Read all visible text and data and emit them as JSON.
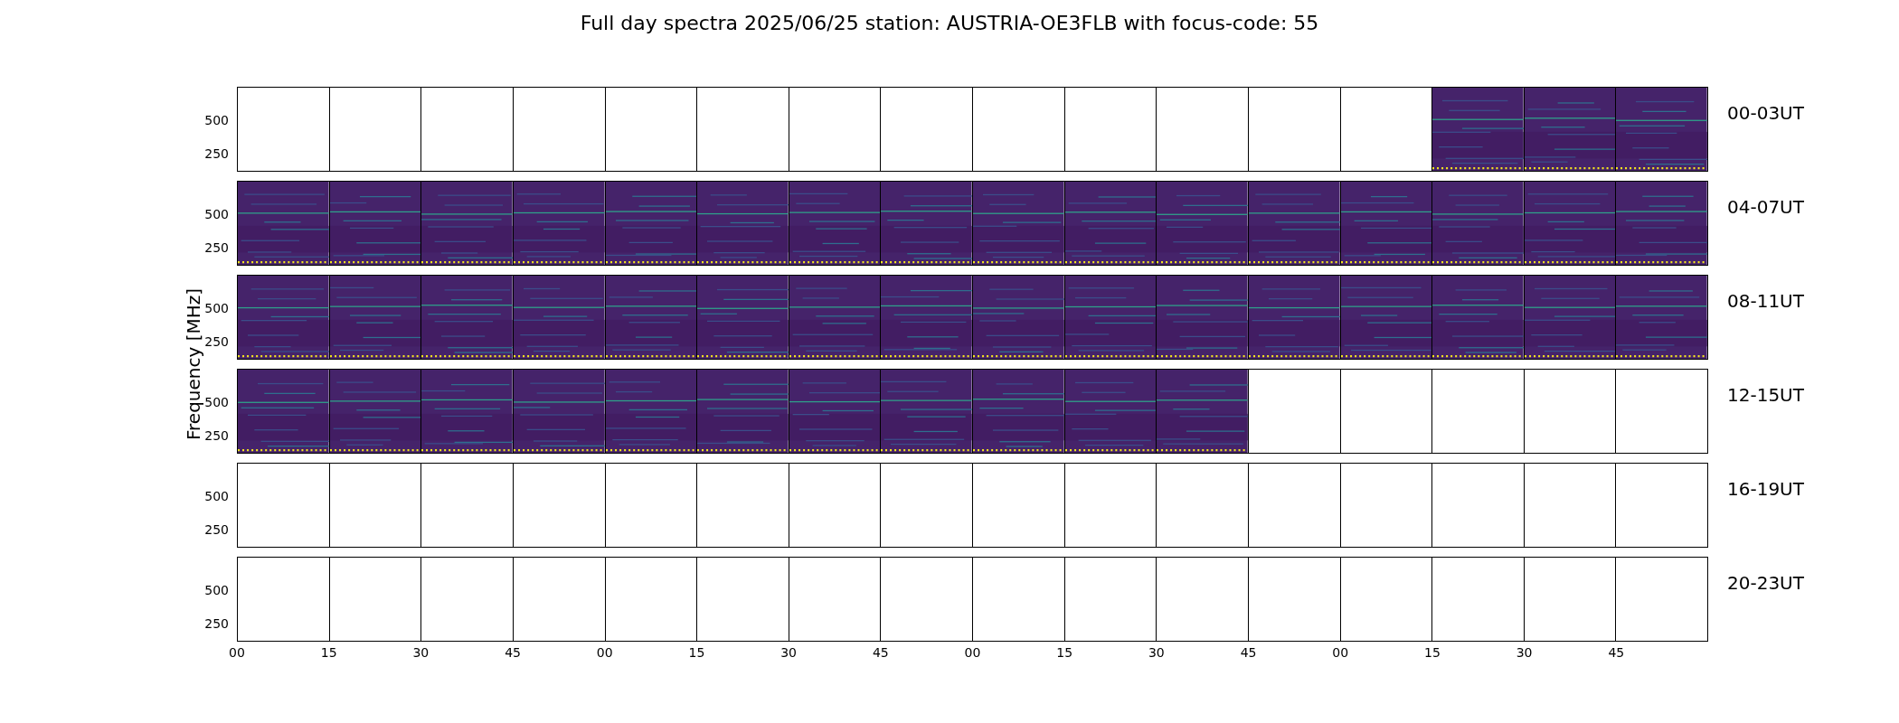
{
  "title": "Full day spectra 2025/06/25 station: AUSTRIA-OE3FLB with focus-code: 55",
  "ylabel": "Frequency [MHz]",
  "rows": [
    {
      "label": "00-03UT",
      "yticks": [
        "500",
        "250"
      ],
      "panels": [
        {
          "kind": "empty"
        },
        {
          "kind": "empty"
        },
        {
          "kind": "empty"
        },
        {
          "kind": "empty"
        },
        {
          "kind": "empty"
        },
        {
          "kind": "empty"
        },
        {
          "kind": "empty"
        },
        {
          "kind": "empty"
        },
        {
          "kind": "empty"
        },
        {
          "kind": "empty"
        },
        {
          "kind": "empty"
        },
        {
          "kind": "empty"
        },
        {
          "kind": "empty"
        },
        {
          "kind": "spectrum"
        },
        {
          "kind": "spectrum"
        },
        {
          "kind": "spectrum"
        }
      ]
    },
    {
      "label": "04-07UT",
      "yticks": [
        "500",
        "250"
      ],
      "panels": [
        {
          "kind": "spectrum"
        },
        {
          "kind": "spectrum"
        },
        {
          "kind": "spectrum"
        },
        {
          "kind": "spectrum"
        },
        {
          "kind": "spectrum"
        },
        {
          "kind": "spectrum"
        },
        {
          "kind": "spectrum"
        },
        {
          "kind": "spectrum"
        },
        {
          "kind": "spectrum"
        },
        {
          "kind": "spectrum"
        },
        {
          "kind": "spectrum"
        },
        {
          "kind": "spectrum"
        },
        {
          "kind": "spectrum"
        },
        {
          "kind": "spectrum"
        },
        {
          "kind": "spectrum"
        },
        {
          "kind": "spectrum"
        }
      ]
    },
    {
      "label": "08-11UT",
      "yticks": [
        "500",
        "250"
      ],
      "panels": [
        {
          "kind": "spectrum"
        },
        {
          "kind": "spectrum"
        },
        {
          "kind": "spectrum"
        },
        {
          "kind": "spectrum"
        },
        {
          "kind": "spectrum"
        },
        {
          "kind": "spectrum"
        },
        {
          "kind": "spectrum"
        },
        {
          "kind": "spectrum"
        },
        {
          "kind": "spectrum"
        },
        {
          "kind": "spectrum"
        },
        {
          "kind": "spectrum"
        },
        {
          "kind": "spectrum"
        },
        {
          "kind": "spectrum"
        },
        {
          "kind": "spectrum"
        },
        {
          "kind": "spectrum"
        },
        {
          "kind": "spectrum"
        }
      ]
    },
    {
      "label": "12-15UT",
      "yticks": [
        "500",
        "250"
      ],
      "panels": [
        {
          "kind": "spectrum"
        },
        {
          "kind": "spectrum"
        },
        {
          "kind": "spectrum"
        },
        {
          "kind": "spectrum"
        },
        {
          "kind": "spectrum"
        },
        {
          "kind": "spectrum"
        },
        {
          "kind": "spectrum"
        },
        {
          "kind": "spectrum"
        },
        {
          "kind": "spectrum"
        },
        {
          "kind": "spectrum"
        },
        {
          "kind": "spectrum"
        },
        {
          "kind": "empty"
        },
        {
          "kind": "empty"
        },
        {
          "kind": "empty"
        },
        {
          "kind": "empty"
        },
        {
          "kind": "empty"
        }
      ]
    },
    {
      "label": "16-19UT",
      "yticks": [
        "500",
        "250"
      ],
      "panels": [
        {
          "kind": "empty"
        },
        {
          "kind": "empty"
        },
        {
          "kind": "empty"
        },
        {
          "kind": "empty"
        },
        {
          "kind": "empty"
        },
        {
          "kind": "empty"
        },
        {
          "kind": "empty"
        },
        {
          "kind": "empty"
        },
        {
          "kind": "empty"
        },
        {
          "kind": "empty"
        },
        {
          "kind": "empty"
        },
        {
          "kind": "empty"
        },
        {
          "kind": "empty"
        },
        {
          "kind": "empty"
        },
        {
          "kind": "empty"
        },
        {
          "kind": "empty"
        }
      ]
    },
    {
      "label": "20-23UT",
      "yticks": [
        "500",
        "250"
      ],
      "panels": [
        {
          "kind": "empty"
        },
        {
          "kind": "empty"
        },
        {
          "kind": "empty"
        },
        {
          "kind": "empty"
        },
        {
          "kind": "empty"
        },
        {
          "kind": "empty"
        },
        {
          "kind": "empty"
        },
        {
          "kind": "empty"
        },
        {
          "kind": "empty"
        },
        {
          "kind": "empty"
        },
        {
          "kind": "empty"
        },
        {
          "kind": "empty"
        },
        {
          "kind": "empty"
        },
        {
          "kind": "empty"
        },
        {
          "kind": "empty"
        },
        {
          "kind": "empty"
        }
      ]
    }
  ],
  "xticks": [
    "00",
    "15",
    "30",
    "45",
    "00",
    "15",
    "30",
    "45",
    "00",
    "15",
    "30",
    "45",
    "00",
    "15",
    "30",
    "45"
  ]
}
